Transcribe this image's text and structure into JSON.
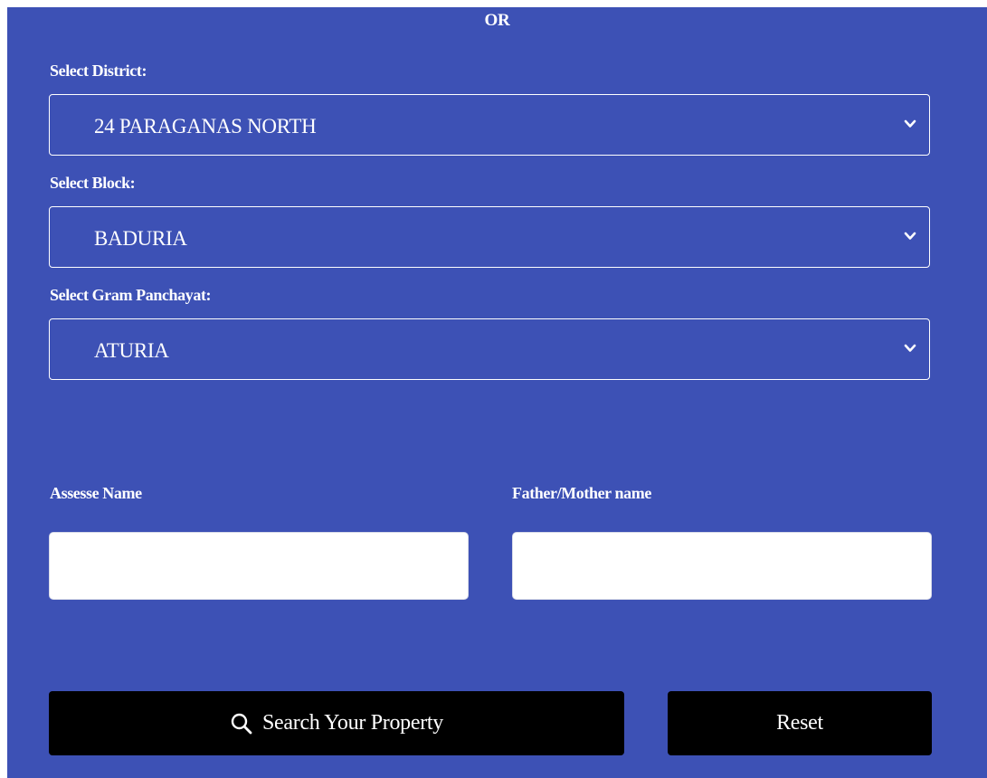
{
  "separator_text": "OR",
  "district": {
    "label": "Select District:",
    "selected": "24 PARAGANAS NORTH"
  },
  "block": {
    "label": "Select Block:",
    "selected": "BADURIA"
  },
  "gram_panchayat": {
    "label": "Select Gram Panchayat:",
    "selected": "ATURIA"
  },
  "assesse": {
    "label": "Assesse Name",
    "value": ""
  },
  "parent": {
    "label": "Father/Mother name",
    "value": ""
  },
  "actions": {
    "search_label": "Search Your Property",
    "search_icon": "search-icon",
    "reset_label": "Reset"
  },
  "colors": {
    "panel_background": "#3d51b5",
    "button_background": "#000000",
    "text": "#ffffff"
  }
}
